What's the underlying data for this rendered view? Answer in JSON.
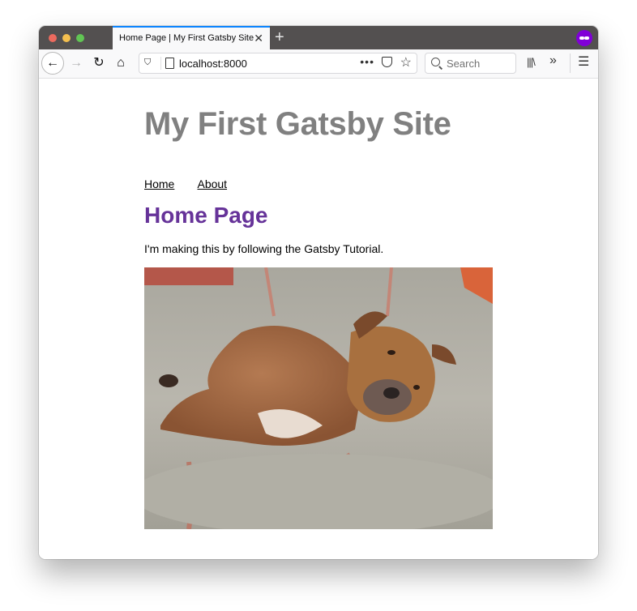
{
  "browser": {
    "tab_title": "Home Page | My First Gatsby Site",
    "tab_close_icon": "close-icon",
    "new_tab_label": "+",
    "url": "localhost:8000",
    "url_more_label": "•••",
    "search_placeholder": "Search",
    "back_glyph": "←",
    "forward_glyph": "→",
    "reload_glyph": "↻",
    "home_glyph": "⌂",
    "star_glyph": "☆",
    "library_glyph": "|||\\",
    "overflow_glyph": "»",
    "menu_glyph": "☰",
    "close_glyph": "✕",
    "shield_glyph": "⛉",
    "accent_color": "#0a84ff",
    "private_mask_color": "#8000d7"
  },
  "page": {
    "site_title": "My First Gatsby Site",
    "nav": [
      {
        "label": "Home"
      },
      {
        "label": "About"
      }
    ],
    "heading": "Home Page",
    "intro": "I'm making this by following the Gatsby Tutorial.",
    "image_alt": "Brown dog curled up in a gray striped dog bed",
    "title_color": "#808080",
    "heading_color": "#663399"
  }
}
